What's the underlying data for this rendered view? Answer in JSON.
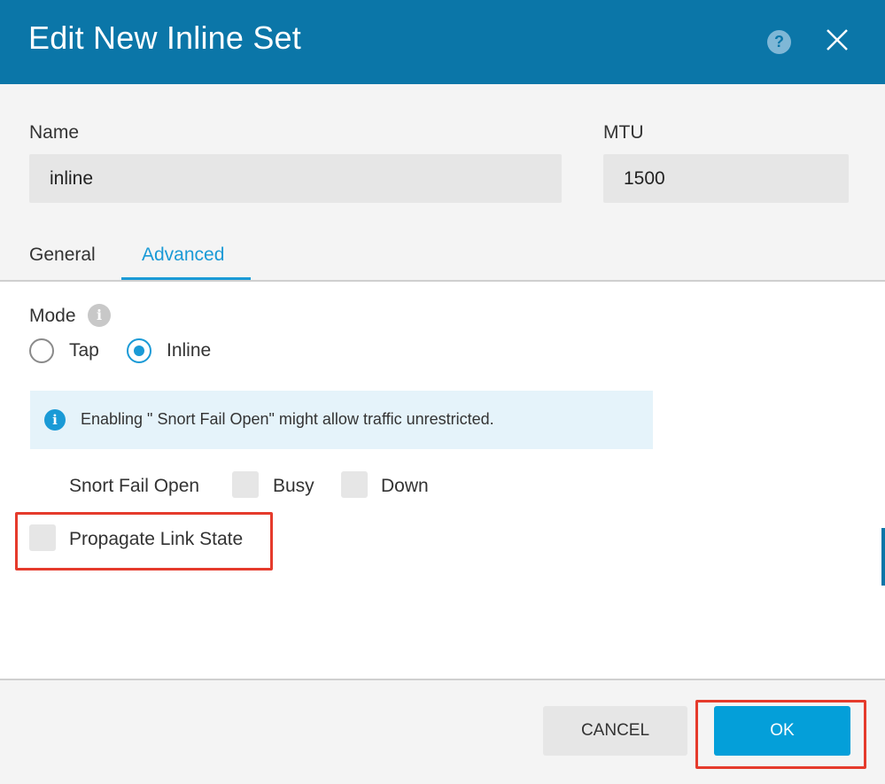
{
  "dialog": {
    "title": "Edit New Inline Set",
    "help_icon": "question-circle-icon",
    "close_icon": "close-x-icon"
  },
  "fields": {
    "name": {
      "label": "Name",
      "value": "inline"
    },
    "mtu": {
      "label": "MTU",
      "value": "1500"
    }
  },
  "tabs": [
    {
      "label": "General",
      "active": false
    },
    {
      "label": "Advanced",
      "active": true
    }
  ],
  "mode": {
    "label": "Mode",
    "info_icon": "info-icon",
    "options": [
      {
        "label": "Tap",
        "selected": false
      },
      {
        "label": "Inline",
        "selected": true
      }
    ]
  },
  "info_banner": {
    "icon": "info-icon",
    "text": "Enabling \" Snort Fail Open\"  might allow traffic unrestricted."
  },
  "snort_fail_open": {
    "label": "Snort Fail Open",
    "options": [
      {
        "label": "Busy",
        "checked": false
      },
      {
        "label": "Down",
        "checked": false
      }
    ]
  },
  "propagate_link_state": {
    "label": "Propagate Link State",
    "checked": false
  },
  "footer": {
    "cancel_label": "CANCEL",
    "ok_label": "OK"
  },
  "colors": {
    "header": "#0b76a8",
    "accent": "#1a9ad6",
    "ok_button": "#049fd9",
    "highlight": "#e53b2c"
  }
}
